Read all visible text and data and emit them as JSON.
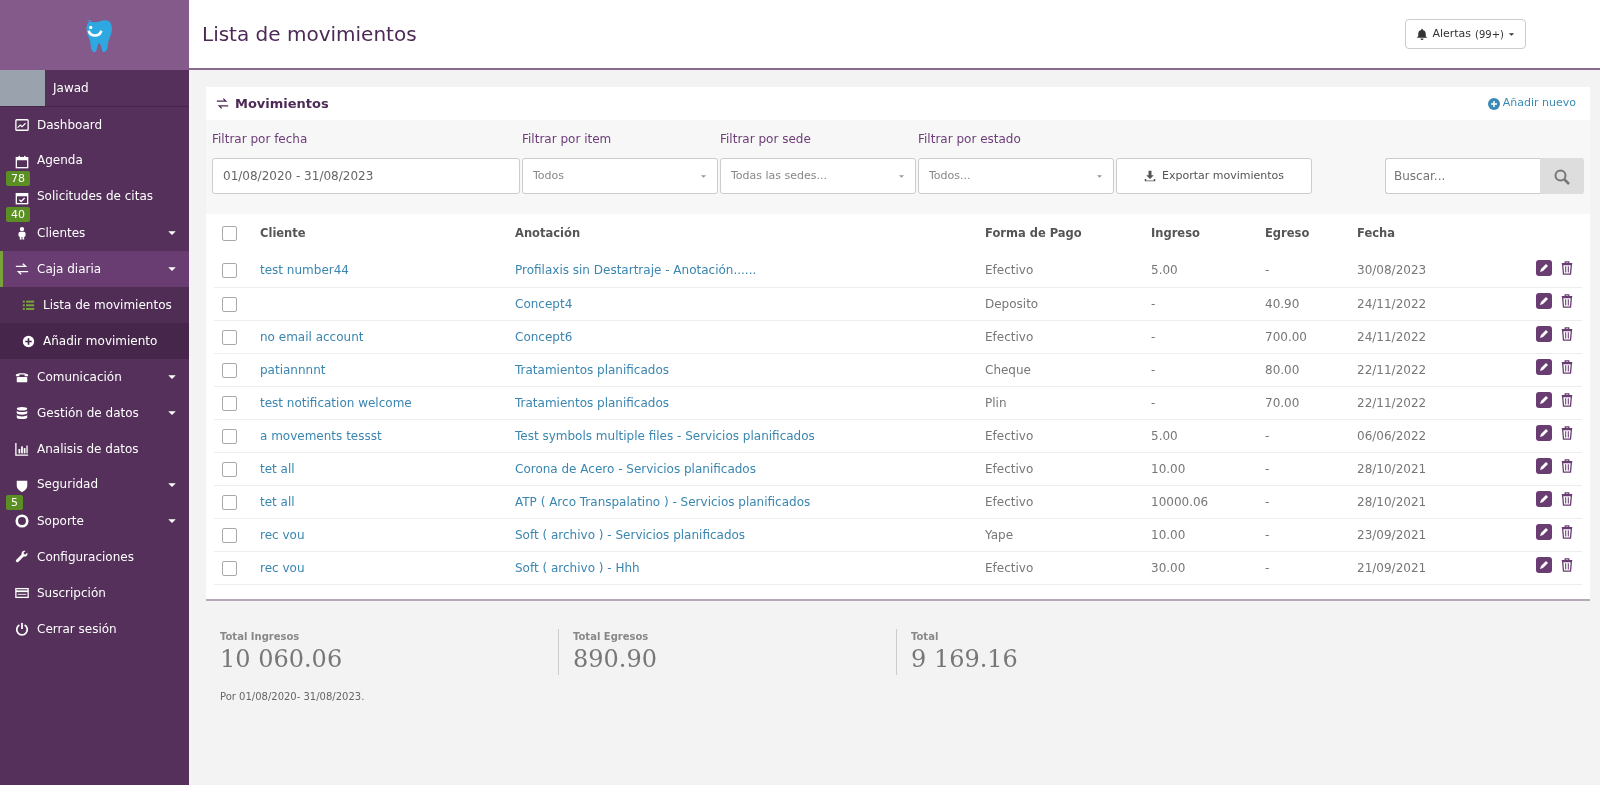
{
  "user": {
    "name": "Jawad"
  },
  "sidebar": {
    "items": [
      {
        "label": "Dashboard",
        "kind": "link",
        "selected": false
      },
      {
        "label": "Agenda",
        "kind": "link",
        "selected": false,
        "badge": "78"
      },
      {
        "label": "Solicitudes de citas",
        "kind": "link",
        "selected": false,
        "badge": "40"
      },
      {
        "label": "Clientes",
        "kind": "menu",
        "selected": false
      },
      {
        "label": "Caja diaria",
        "kind": "menu",
        "selected": true,
        "children": [
          {
            "label": "Lista de movimientos",
            "selected": true
          },
          {
            "label": "Añadir movimiento",
            "selected": false
          }
        ]
      },
      {
        "label": "Comunicación",
        "kind": "menu",
        "selected": false
      },
      {
        "label": "Gestión de datos",
        "kind": "menu",
        "selected": false
      },
      {
        "label": "Analisis de datos",
        "kind": "link",
        "selected": false
      },
      {
        "label": "Seguridad",
        "kind": "menu",
        "selected": false,
        "badge": "5"
      },
      {
        "label": "Soporte",
        "kind": "menu",
        "selected": false
      },
      {
        "label": "Configuraciones",
        "kind": "link",
        "selected": false
      },
      {
        "label": "Suscripción",
        "kind": "link",
        "selected": false
      },
      {
        "label": "Cerrar sesión",
        "kind": "link",
        "selected": false
      }
    ]
  },
  "header": {
    "title": "Lista de movimientos",
    "alerts_button": {
      "label": "Alertas",
      "count": "(99+)"
    }
  },
  "panel": {
    "title": "Movimientos",
    "add_link": "Añadir nuevo",
    "filters": [
      {
        "label": "Filtrar por fecha",
        "kind": "input",
        "value": "01/08/2020 - 31/08/2023"
      },
      {
        "label": "Filtrar por item",
        "kind": "select",
        "value": "Todos"
      },
      {
        "label": "Filtrar por sede",
        "kind": "select",
        "value": "Todas las sedes..."
      },
      {
        "label": "Filtrar por estado",
        "kind": "select",
        "value": "Todos..."
      }
    ],
    "export_button": "Exportar movimientos",
    "search": {
      "placeholder": "Buscar..."
    }
  },
  "table": {
    "select_all_checked": false,
    "columns": [
      "Cliente",
      "Anotación",
      "Forma de Pago",
      "Ingreso",
      "Egreso",
      "Fecha"
    ],
    "rows": [
      {
        "checked": false,
        "cliente": "test number44",
        "anotacion": "Profilaxis sin Destartraje - Anotación......",
        "forma": "Efectivo",
        "ingreso": "5.00",
        "egreso": "-",
        "fecha": "30/08/2023"
      },
      {
        "checked": false,
        "cliente": "",
        "anotacion": "Concept4",
        "forma": "Deposito",
        "ingreso": "-",
        "egreso": "40.90",
        "fecha": "24/11/2022"
      },
      {
        "checked": false,
        "cliente": "no email account",
        "anotacion": "Concept6",
        "forma": "Efectivo",
        "ingreso": "-",
        "egreso": "700.00",
        "fecha": "24/11/2022"
      },
      {
        "checked": false,
        "cliente": "patiannnnt",
        "anotacion": "Tratamientos planificados",
        "forma": "Cheque",
        "ingreso": "-",
        "egreso": "80.00",
        "fecha": "22/11/2022"
      },
      {
        "checked": false,
        "cliente": "test notification welcome",
        "anotacion": "Tratamientos planificados",
        "forma": "Plin",
        "ingreso": "-",
        "egreso": "70.00",
        "fecha": "22/11/2022"
      },
      {
        "checked": false,
        "cliente": "a movements tessst",
        "anotacion": "Test symbols multiple files - Servicios planificados",
        "forma": "Efectivo",
        "ingreso": "5.00",
        "egreso": "-",
        "fecha": "06/06/2022"
      },
      {
        "checked": false,
        "cliente": "tet all",
        "anotacion": "Corona de Acero - Servicios planificados",
        "forma": "Efectivo",
        "ingreso": "10.00",
        "egreso": "-",
        "fecha": "28/10/2021"
      },
      {
        "checked": false,
        "cliente": "tet all",
        "anotacion": "ATP ( Arco Transpalatino ) - Servicios planificados",
        "forma": "Efectivo",
        "ingreso": "10000.06",
        "egreso": "-",
        "fecha": "28/10/2021"
      },
      {
        "checked": false,
        "cliente": "rec vou",
        "anotacion": "Soft ( archivo ) - Servicios planificados",
        "forma": "Yape",
        "ingreso": "10.00",
        "egreso": "-",
        "fecha": "23/09/2021"
      },
      {
        "checked": false,
        "cliente": "rec vou",
        "anotacion": "Soft ( archivo ) - Hhh",
        "forma": "Efectivo",
        "ingreso": "30.00",
        "egreso": "-",
        "fecha": "21/09/2021"
      }
    ]
  },
  "totals": [
    {
      "label": "Total Ingresos",
      "value": "10 060.06"
    },
    {
      "label": "Total Egresos",
      "value": "890.90"
    },
    {
      "label": "Total",
      "value": "9 169.16"
    }
  ],
  "period_note": "Por 01/08/2020- 31/08/2023."
}
